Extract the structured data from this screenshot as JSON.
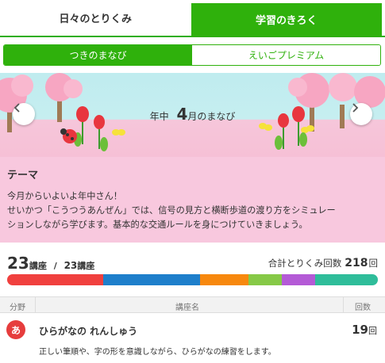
{
  "tabs": [
    {
      "label": "日々のとりくみ",
      "active": false
    },
    {
      "label": "学習のきろく",
      "active": true
    }
  ],
  "subtabs": [
    {
      "label": "つきのまなび",
      "active": true
    },
    {
      "label": "えいごプレミアム",
      "active": false
    }
  ],
  "banner": {
    "grade": "年中",
    "month_number": "4",
    "month_suffix": "月のまなび"
  },
  "theme": {
    "heading": "テーマ",
    "lines": [
      "今月からいよいよ年中さん！",
      "せいかつ「こうつうあんぜん」では、信号の見方と横断歩道の渡り方をシミュレー",
      "ションしながら学びます。基本的な交通ルールを身につけていきましょう。"
    ]
  },
  "summary": {
    "lessons_done": "23",
    "lessons_unit": "講座",
    "separator": "/",
    "lessons_total": "23",
    "lessons_total_unit": "講座",
    "total_label": "合計とりくみ回数",
    "total_count": "218",
    "count_unit": "回"
  },
  "progress_segments": [
    {
      "color": "#f0403e",
      "share": 0.26
    },
    {
      "color": "#1e7fcb",
      "share": 0.26
    },
    {
      "color": "#f7880e",
      "share": 0.13
    },
    {
      "color": "#86c947",
      "share": 0.09
    },
    {
      "color": "#b45ad6",
      "share": 0.09
    },
    {
      "color": "#2fbd9a",
      "share": 0.17
    }
  ],
  "table": {
    "headers": {
      "field": "分野",
      "course": "講座名",
      "count": "回数"
    },
    "rows": [
      {
        "icon_char": "あ",
        "icon_name": "hiragana-icon",
        "title": "ひらがなの れんしゅう",
        "count": "19",
        "unit": "回",
        "description": "正しい筆順や、字の形を意識しながら、ひらがなの練習をします。"
      }
    ]
  }
}
